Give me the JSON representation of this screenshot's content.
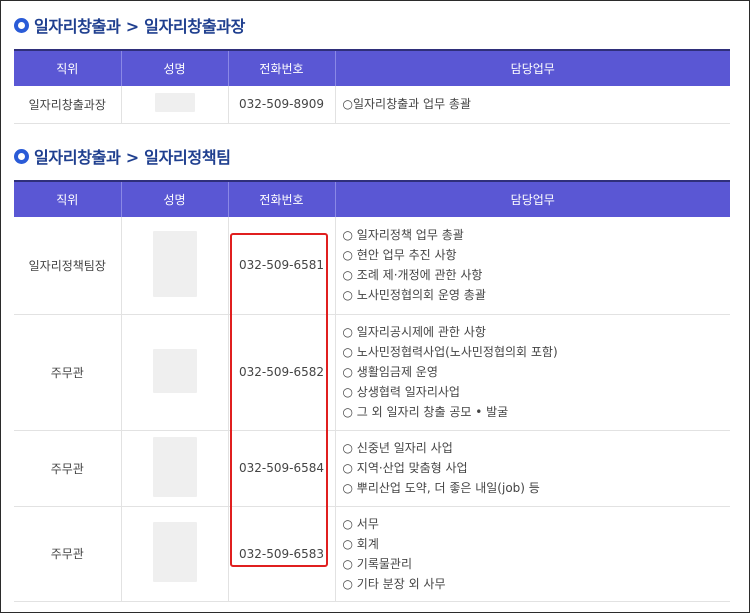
{
  "section1": {
    "title": "일자리창출과 > 일자리창출과장",
    "headers": [
      "직위",
      "성명",
      "전화번호",
      "담당업무"
    ],
    "rows": [
      {
        "position": "일자리창출과장",
        "phone": "032-509-8909",
        "duties": [
          "○일자리창출과 업무 총괄"
        ]
      }
    ]
  },
  "section2": {
    "title": "일자리창출과 > 일자리정책팀",
    "headers": [
      "직위",
      "성명",
      "전화번호",
      "담당업무"
    ],
    "rows": [
      {
        "position": "일자리정책팀장",
        "phone": "032-509-6581",
        "duties": [
          "○ 일자리정책 업무 총괄",
          "○ 현안 업무 추진 사항",
          "○ 조례 제·개정에 관한 사항",
          "○ 노사민정협의회 운영 총괄"
        ]
      },
      {
        "position": "주무관",
        "phone": "032-509-6582",
        "duties": [
          "○ 일자리공시제에 관한 사항",
          "○ 노사민정협력사업(노사민정협의회 포함)",
          "○ 생활임금제 운영",
          "○ 상생협력 일자리사업",
          "○ 그 외 일자리 창출 공모 • 발굴"
        ]
      },
      {
        "position": "주무관",
        "phone": "032-509-6584",
        "duties": [
          "○ 신중년 일자리 사업",
          "○ 지역·산업 맞춤형 사업",
          "○ 뿌리산업 도약, 더 좋은 내일(job) 등"
        ]
      },
      {
        "position": "주무관",
        "phone": "032-509-6583",
        "duties": [
          "○ 서무",
          "○ 회계",
          "○ 기록물관리",
          "○ 기타 분장 외 사무"
        ]
      }
    ]
  },
  "colors": {
    "header_bg": "#5a57d4",
    "title": "#1f3f8f",
    "highlight": "#e01f1f"
  }
}
